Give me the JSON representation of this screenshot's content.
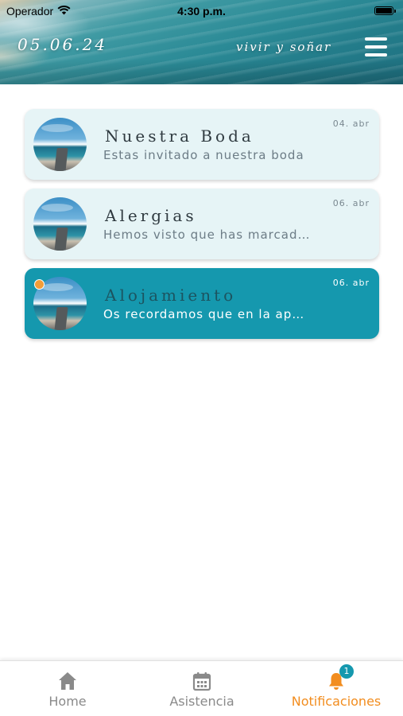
{
  "status_bar": {
    "carrier": "Operador",
    "time": "4:30 p.m."
  },
  "header": {
    "date": "05.06.24",
    "tagline": "vivir y soñar"
  },
  "notifications": [
    {
      "title": "Nuestra Boda",
      "message": "Estas invitado a nuestra boda",
      "date": "04. abr",
      "unread": false
    },
    {
      "title": "Alergias",
      "message": "Hemos visto que has marcad…",
      "date": "06. abr",
      "unread": false
    },
    {
      "title": "Alojamiento",
      "message": "Os recordamos que en la ap…",
      "date": "06. abr",
      "unread": true
    }
  ],
  "tabbar": {
    "home": "Home",
    "asistencia": "Asistencia",
    "notificaciones": "Notificaciones",
    "badge_count": "1"
  },
  "colors": {
    "accent": "#1598ae",
    "active_tab": "#f28d1f",
    "unread_dot": "#f29d38",
    "card_bg": "#e6f4f6"
  },
  "icons": [
    "wifi-icon",
    "battery-icon",
    "menu-icon",
    "home-icon",
    "calendar-icon",
    "bell-icon"
  ]
}
